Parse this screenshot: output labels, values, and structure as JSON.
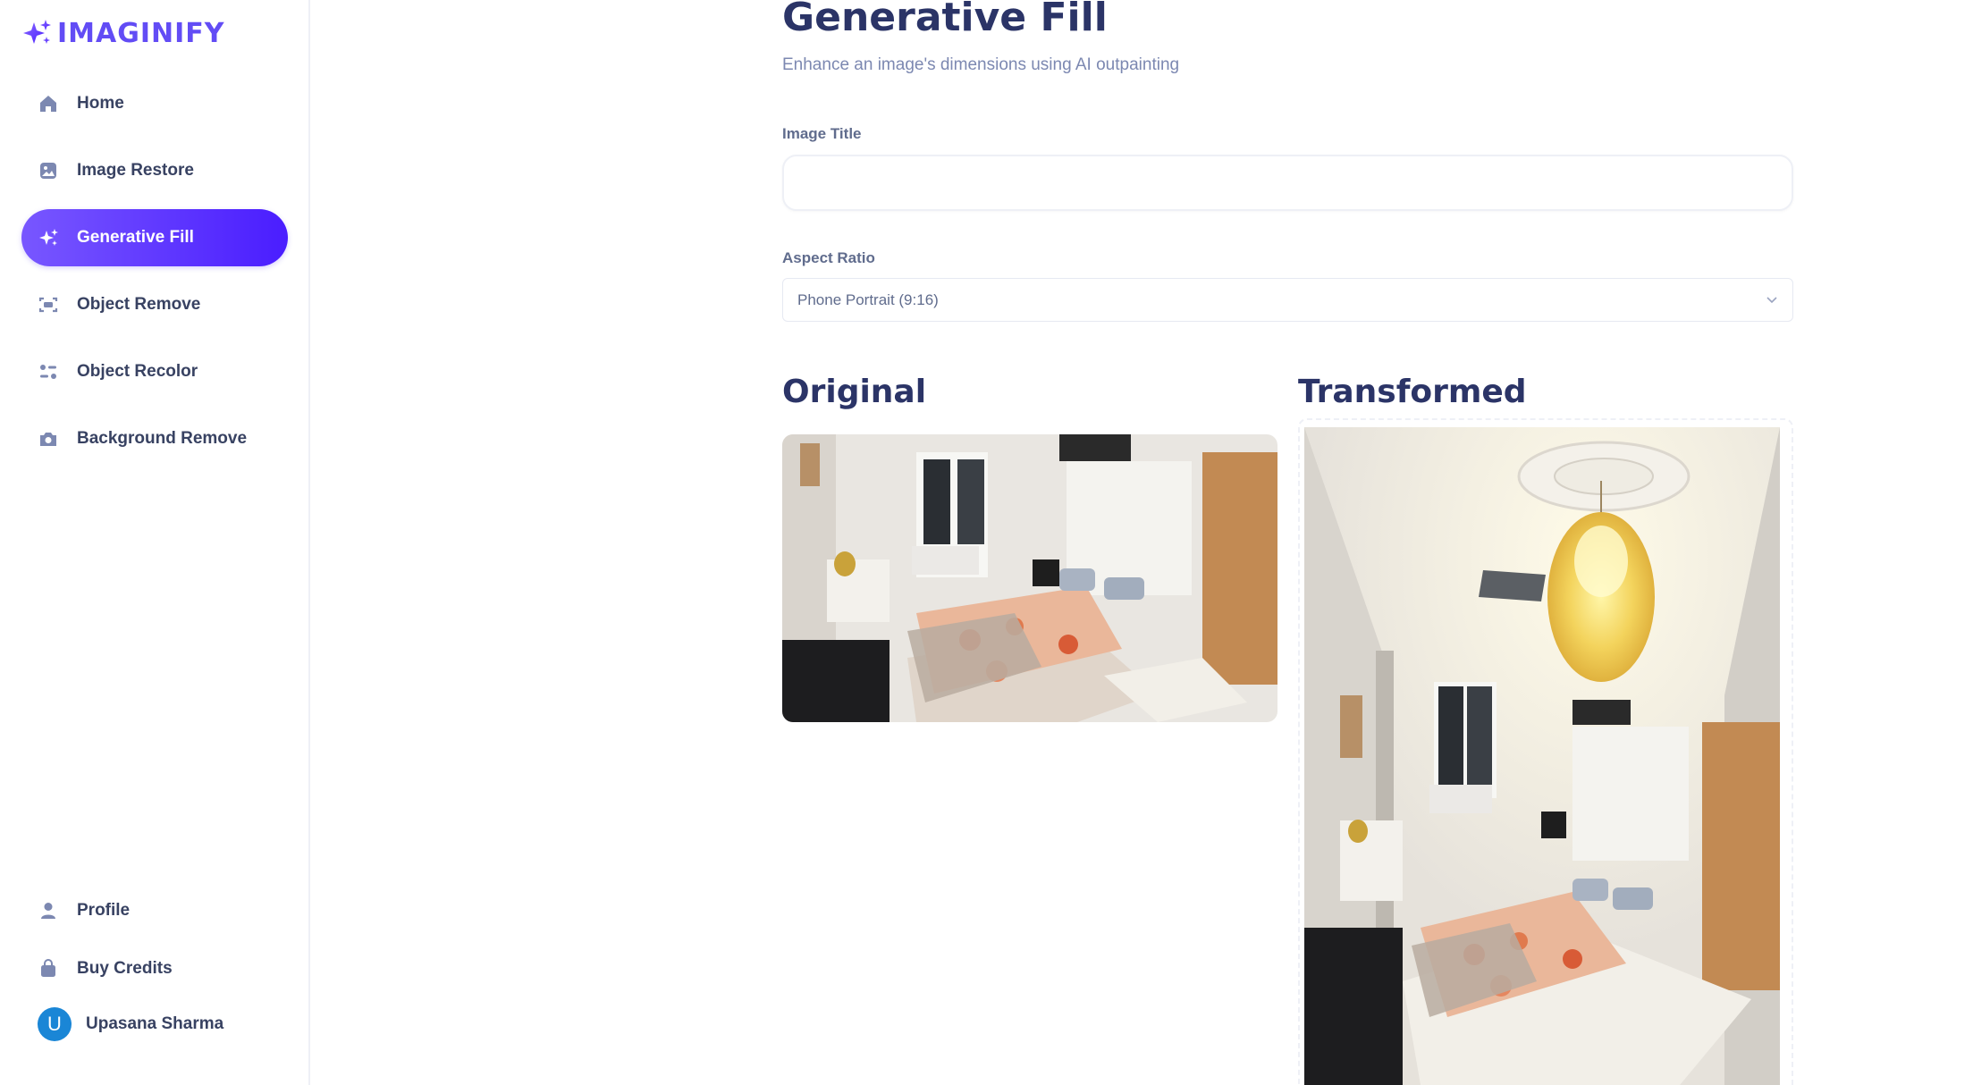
{
  "app": {
    "logo_text": "IMAGINIFY",
    "brand_color": "#624cf5"
  },
  "sidebar": {
    "items": [
      {
        "label": "Home",
        "icon": "home-icon"
      },
      {
        "label": "Image Restore",
        "icon": "image-icon"
      },
      {
        "label": "Generative Fill",
        "icon": "stars-icon",
        "active": true
      },
      {
        "label": "Object Remove",
        "icon": "scan-icon"
      },
      {
        "label": "Object Recolor",
        "icon": "filter-icon"
      },
      {
        "label": "Background Remove",
        "icon": "camera-icon"
      }
    ],
    "bottom_items": [
      {
        "label": "Profile",
        "icon": "profile-icon"
      },
      {
        "label": "Buy Credits",
        "icon": "bag-icon"
      }
    ],
    "user": {
      "initial": "U",
      "name": "Upasana Sharma"
    }
  },
  "main": {
    "title": "Generative Fill",
    "subtitle": "Enhance an image's dimensions using AI outpainting",
    "image_title_label": "Image Title",
    "image_title_value": "",
    "aspect_ratio_label": "Aspect Ratio",
    "aspect_ratio_value": "Phone Portrait (9:16)",
    "original_heading": "Original",
    "transformed_heading": "Transformed"
  },
  "colors": {
    "active_gradient_start": "#7857ff",
    "active_gradient_end": "#4a1dff",
    "heading": "#2b3467",
    "text": "#384262",
    "muted": "#7c88b1"
  }
}
